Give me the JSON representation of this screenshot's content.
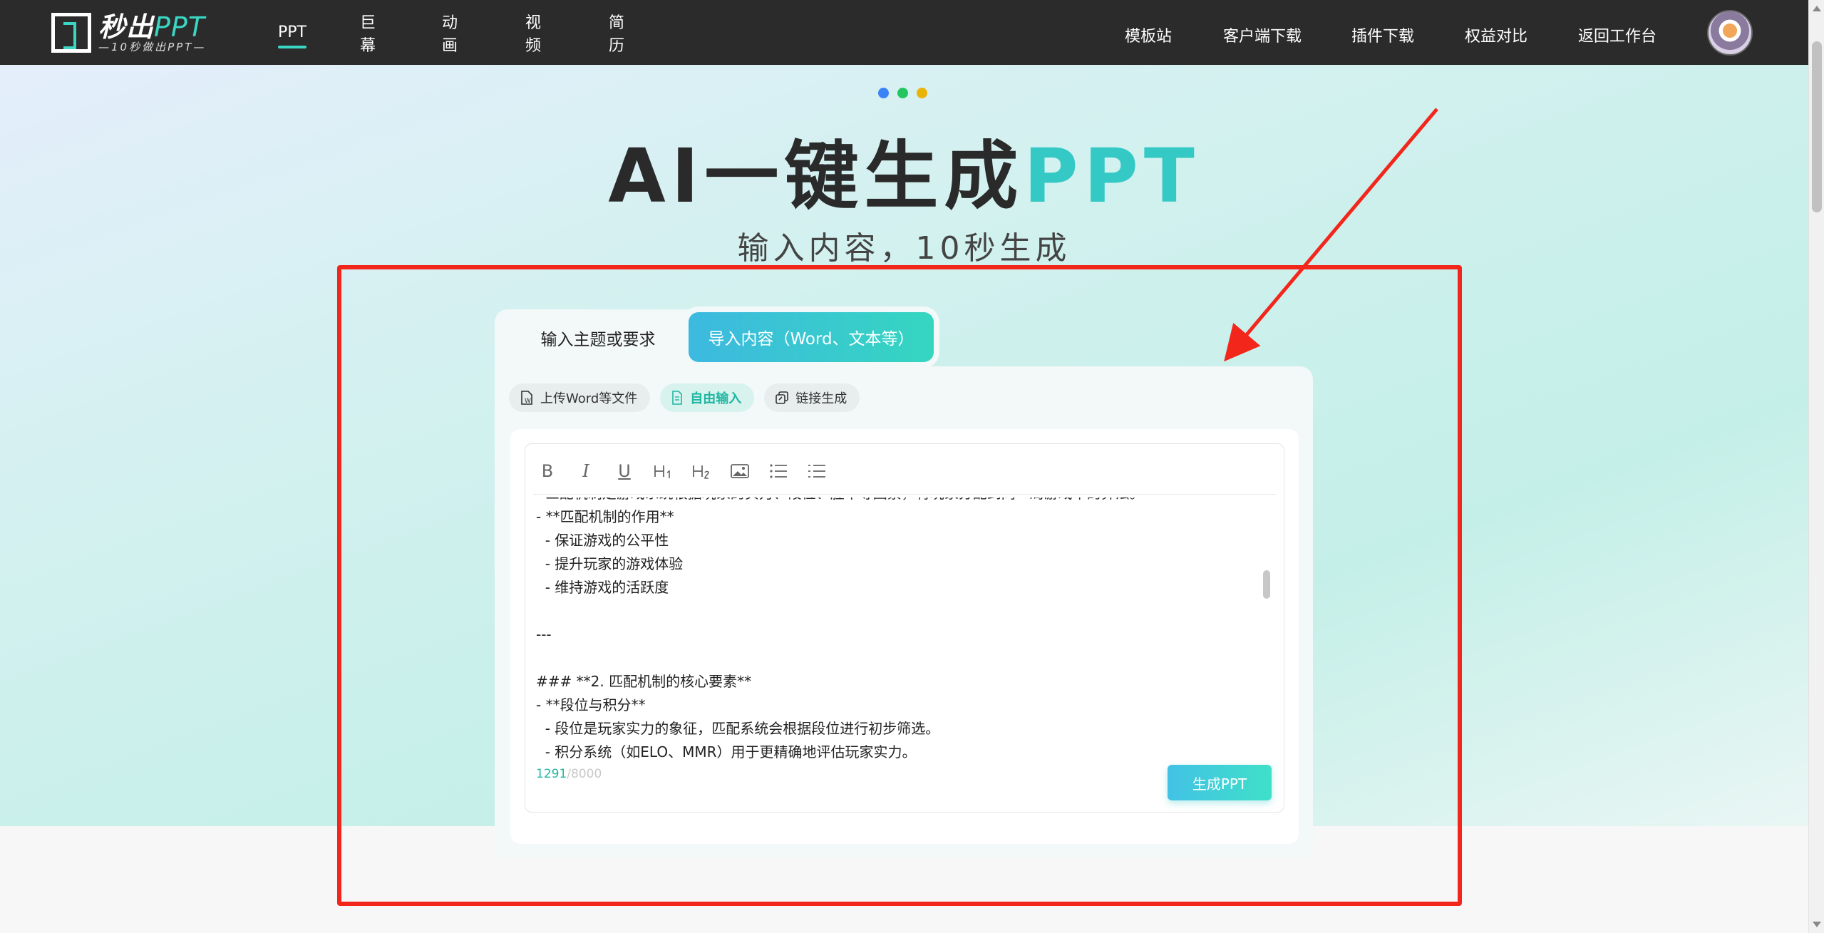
{
  "header": {
    "logo_main": "秒出",
    "logo_ppt": "PPT",
    "logo_sub": "—10秒做出PPT—",
    "nav_left": [
      {
        "label": "PPT",
        "active": true
      },
      {
        "label": "巨幕",
        "active": false
      },
      {
        "label": "动画",
        "active": false
      },
      {
        "label": "视频",
        "active": false
      },
      {
        "label": "简历",
        "active": false
      }
    ],
    "nav_right": [
      "模板站",
      "客户端下载",
      "插件下载",
      "权益对比",
      "返回工作台"
    ],
    "avatar_icon": "fox-avatar-icon"
  },
  "hero": {
    "dot_colors": [
      "#3b82f6",
      "#22c55e",
      "#eab308"
    ],
    "title_main": "AI一键生成",
    "title_accent": "PPT",
    "subtitle": "输入内容，10秒生成"
  },
  "tabs": {
    "topic": "输入主题或要求",
    "import": "导入内容（Word、文本等）"
  },
  "chips": [
    {
      "label": "上传Word等文件",
      "icon": "word-file-icon",
      "active": false
    },
    {
      "label": "自由输入",
      "icon": "document-icon",
      "active": true
    },
    {
      "label": "链接生成",
      "icon": "link-icon",
      "active": false
    }
  ],
  "toolbar": [
    "B",
    "I",
    "U",
    "H1",
    "H2",
    "image",
    "ordered-list",
    "bullet-list"
  ],
  "editor": {
    "lines": [
      "  匹配机制是游戏系统根据玩家的实力、段位、胜率等因素，将玩家分配到同一局游戏中的算法。",
      "- **匹配机制的作用**",
      "  - 保证游戏的公平性",
      "  - 提升玩家的游戏体验",
      "  - 维持游戏的活跃度",
      "",
      "---",
      "",
      "### **2. 匹配机制的核心要素**",
      "- **段位与积分**",
      "  - 段位是玩家实力的象征，匹配系统会根据段位进行初步筛选。",
      "  - 积分系统（如ELO、MMR）用于更精确地评估玩家实力。"
    ],
    "count": "1291",
    "max": "/8000",
    "generate_label": "生成PPT"
  },
  "annotation": {
    "box_color": "#f2261b"
  }
}
